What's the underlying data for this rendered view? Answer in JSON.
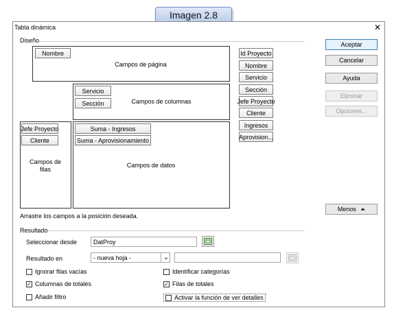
{
  "caption": "Imagen 2.8",
  "window": {
    "title": "Tabla dinámica",
    "close_glyph": "✕"
  },
  "diseno": {
    "label": "Diseño",
    "page_area": {
      "label": "Campos de página",
      "fields": [
        "Nombre"
      ]
    },
    "column_area": {
      "label": "Campos de columnas",
      "fields": [
        "Servicio",
        "Sección"
      ]
    },
    "row_area": {
      "label_line1": "Campos de",
      "label_line2": "filas",
      "fields": [
        "Jefe Proyecto",
        "Cliente"
      ]
    },
    "data_area": {
      "label": "Campos de datos",
      "fields": [
        "Suma - Ingresos",
        "Suma - Aprovisionamiento"
      ]
    },
    "available_fields": [
      "Id Proyecto",
      "Nombre",
      "Servicio",
      "Sección",
      "Jefe Proyecto",
      "Cliente",
      "Ingresos",
      "Aprovision..."
    ],
    "hint": "Arrastre los campos a la posición deseada."
  },
  "buttons": {
    "accept": "Aceptar",
    "cancel": "Cancelar",
    "help": "Ayuda",
    "delete": "Eliminar",
    "options": "Opciones...",
    "less": "Menos",
    "less_icon": "⏶"
  },
  "resultado": {
    "label": "Resultado",
    "select_from_label": "Seleccionar desde",
    "select_from_value": "DatProy",
    "result_in_label": "Resultado en",
    "result_in_value": "- nueva hoja -",
    "result_in_text": "",
    "dropdown_glyph": "⌄"
  },
  "options": [
    {
      "label": "Ignorar filas vacías",
      "checked": false
    },
    {
      "label": "Identificar categorías",
      "checked": false
    },
    {
      "label": "Columnas de totales",
      "checked": true
    },
    {
      "label": "Filas de totales",
      "checked": true
    },
    {
      "label": "Añadir filtro",
      "checked": false
    },
    {
      "label": "Activar la función de ver detalles",
      "checked": false
    }
  ],
  "check_glyph": "✓"
}
